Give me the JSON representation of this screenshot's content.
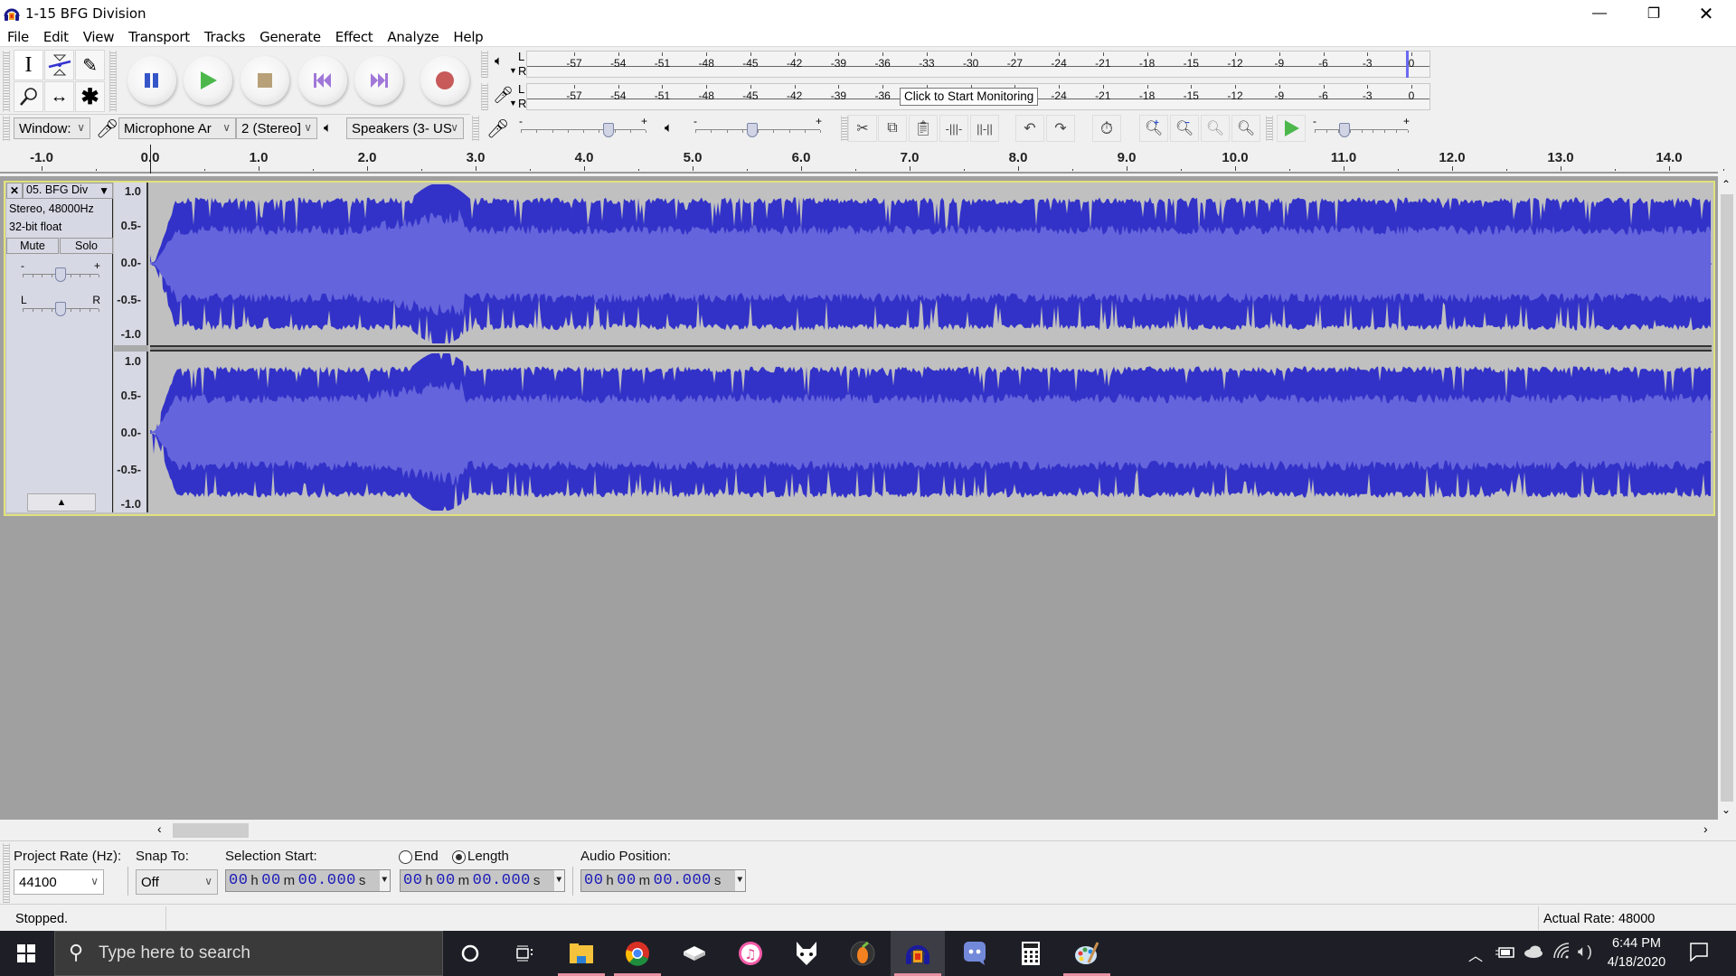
{
  "window": {
    "title": "1-15 BFG Division",
    "controls": {
      "minimize": "—",
      "maximize": "❐",
      "close": "✕"
    }
  },
  "menu": [
    "File",
    "Edit",
    "View",
    "Transport",
    "Tracks",
    "Generate",
    "Effect",
    "Analyze",
    "Help"
  ],
  "tools": {
    "selection": "I",
    "envelope": "envelope-tool",
    "draw": "✎",
    "zoom": "zoom-tool",
    "timeshift": "↔",
    "multi": "✱"
  },
  "transport": [
    "pause",
    "play",
    "stop",
    "skip-to-start",
    "skip-to-end",
    "record"
  ],
  "meters": {
    "playback_channels": [
      "L",
      "R"
    ],
    "record_channels": [
      "L",
      "R"
    ],
    "scale": [
      "-57",
      "-54",
      "-51",
      "-48",
      "-45",
      "-42",
      "-39",
      "-36",
      "-33",
      "-30",
      "-27",
      "-24",
      "-21",
      "-18",
      "-15",
      "-12",
      "-9",
      "-6",
      "-3",
      "0"
    ],
    "record_tooltip": "Click to Start Monitoring"
  },
  "device": {
    "host": "Windows",
    "host_display": "Window:",
    "recording_device": "Microphone Ar",
    "channels": "2 (Stereo)",
    "channels_display": "2 (Stereo]",
    "playback_device": "Speakers (3- US"
  },
  "mixer": {
    "recording_volume": 0.72,
    "playback_volume": 0.45,
    "minus": "-",
    "plus": "+"
  },
  "play_at_speed": {
    "speed": 0.3,
    "minus": "-",
    "plus": "+"
  },
  "ruler": {
    "labels": [
      "-1.0",
      "0.0",
      "1.0",
      "2.0",
      "3.0",
      "4.0",
      "5.0",
      "6.0",
      "7.0",
      "8.0",
      "9.0",
      "10.0",
      "11.0",
      "12.0",
      "13.0",
      "14.0"
    ],
    "start": -1.0,
    "end": 14.4
  },
  "track": {
    "name": "05. BFG Div",
    "format": "Stereo, 48000Hz",
    "sample": "32-bit float",
    "mute": "Mute",
    "solo": "Solo",
    "gain_minus": "-",
    "gain_plus": "+",
    "pan_left": "L",
    "pan_right": "R",
    "gain": 0.5,
    "pan": 0.5,
    "collapse": "▲",
    "close": "✕",
    "menu": "▼",
    "amplitude_labels": [
      "1.0",
      "0.5-",
      "0.0-",
      "-0.5-",
      "-1.0"
    ],
    "wave_color": "#3232c8",
    "rms_color": "#6464dc"
  },
  "selection_toolbar": {
    "project_rate_label": "Project Rate (Hz):",
    "project_rate": "44100",
    "snap_label": "Snap To:",
    "snap_value": "Off",
    "selection_start_label": "Selection Start:",
    "end_label": "End",
    "length_label": "Length",
    "length_selected": true,
    "audio_position_label": "Audio Position:",
    "selection_start": {
      "h": "00",
      "m": "00",
      "s": "00.000"
    },
    "selection_length": {
      "h": "00",
      "m": "00",
      "s": "00.000"
    },
    "audio_position": {
      "h": "00",
      "m": "00",
      "s": "00.000"
    },
    "units": {
      "h": "h",
      "m": "m",
      "s": "s"
    }
  },
  "status": {
    "state": "Stopped.",
    "actual_rate": "Actual Rate: 48000"
  },
  "taskbar": {
    "search_placeholder": "Type here to search",
    "apps": [
      "cortana",
      "task-view",
      "file-explorer",
      "chrome",
      "storage-app",
      "itunes",
      "foobar-fox",
      "fl-studio",
      "audacity",
      "discord",
      "calculator",
      "paint"
    ],
    "time": "6:44 PM",
    "date": "4/18/2020"
  }
}
